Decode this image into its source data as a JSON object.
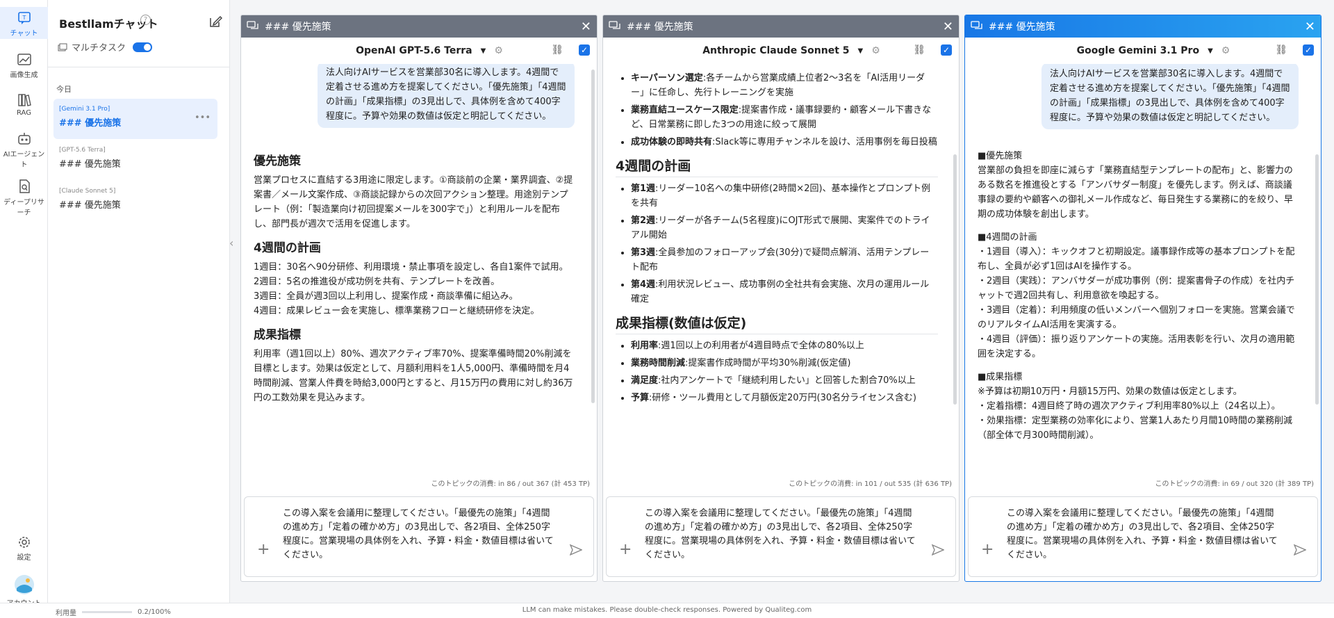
{
  "app": {
    "title": "Bestllamチャット",
    "multitask": "マルチタスク",
    "today": "今日",
    "footer": "LLM can make mistakes. Please double-check responses. Powered by Qualiteg.com",
    "usage_label": "利用量",
    "usage_value": "0.2/100%"
  },
  "rail": [
    "チャット",
    "画像生成",
    "RAG",
    "AIエージェント",
    "ディープリサーチ",
    "設定",
    "アカウント"
  ],
  "convs": [
    {
      "model": "[Gemini 3.1 Pro]",
      "title": "### 優先施策"
    },
    {
      "model": "[GPT-5.6 Terra]",
      "title": "### 優先施策"
    },
    {
      "model": "[Claude Sonnet 5]",
      "title": "### 優先施策"
    }
  ],
  "input_text": "この導入案を会議用に整理してください。「最優先の施策」「4週間の進め方」「定着の確かめ方」の3見出しで、各2項目、全体250字程度に。営業現場の具体例を入れ、予算・料金・数値目標は省いてください。",
  "user_msg": "法人向けAIサービスを営業部30名に導入します。4週間で定着させる進め方を提案してください。「優先施策」「4週間の計画」「成果指標」の3見出しで、具体例を含めて400字程度に。予算や効果の数値は仮定と明記してください。",
  "colors": {
    "header_gray": "#6c7380",
    "header_blue": "#1877e6",
    "accent": "#1a73e8"
  },
  "panels": [
    {
      "title": "### 優先施策",
      "model": "OpenAI GPT-5.6 Terra",
      "tokens": "このトピックの消費: in 86 / out 367 (計 453 TP)",
      "h1": "優先施策",
      "p1": "営業プロセスに直結する3用途に限定します。①商談前の企業・業界調査、②提案書／メール文案作成、③商談記録からの次回アクション整理。用途別テンプレート（例：「製造業向け初回提案メールを300字で」）と利用ルールを配布し、部門長が週次で活用を促進します。",
      "h2": "4週間の計画",
      "l1": "1週目：30名へ90分研修、利用環境・禁止事項を設定し、各自1案件で試用。",
      "l2": "2週目：5名の推進役が成功例を共有、テンプレートを改善。",
      "l3": "3週目：全員が週3回以上利用し、提案作成・商談準備に組込み。",
      "l4": "4週目：成果レビュー会を実施し、標準業務フローと継続研修を決定。",
      "h3": "成果指標",
      "p3": "利用率（週1回以上）80%、週次アクティブ率70%、提案準備時間20%削減を目標とします。効果は仮定として、月額利用料を1人5,000円、準備時間を月4時間削減、営業人件費を時給3,000円とすると、月15万円の費用に対し約36万円の工数効果を見込みます。"
    },
    {
      "title": "### 優先施策",
      "model": "Anthropic Claude Sonnet 5",
      "tokens": "このトピックの消費: in 101 / out 535 (計 636 TP)",
      "b1": "キーパーソン選定",
      "b1t": ":各チームから営業成績上位者2〜3名を「AI活用リーダー」に任命し、先行トレーニングを実施",
      "b2": "業務直結ユースケース限定",
      "b2t": ":提案書作成・議事録要約・顧客メール下書きなど、日常業務に即した3つの用途に絞って展開",
      "b3": "成功体験の即時共有",
      "b3t": ":Slack等に専用チャンネルを設け、活用事例を毎日投稿",
      "h2": "4週間の計画",
      "w1": "第1週",
      "w1t": ":リーダー10名への集中研修(2時間×2回)、基本操作とプロンプト例を共有",
      "w2": "第2週",
      "w2t": ":リーダーが各チーム(5名程度)にOJT形式で展開、実案件でのトライアル開始",
      "w3": "第3週",
      "w3t": ":全員参加のフォローアップ会(30分)で疑問点解消、活用テンプレート配布",
      "w4": "第4週",
      "w4t": ":利用状況レビュー、成功事例の全社共有会実施、次月の運用ルール確定",
      "h3": "成果指標(数値は仮定)",
      "k1": "利用率",
      "k1t": ":週1回以上の利用者が4週目時点で全体の80%以上",
      "k2": "業務時間削減",
      "k2t": ":提案書作成時間が平均30%削減(仮定値)",
      "k3": "満足度",
      "k3t": ":社内アンケートで「継続利用したい」と回答した割合70%以上",
      "k4": "予算",
      "k4t": ":研修・ツール費用として月額仮定20万円(30名分ライセンス含む)"
    },
    {
      "title": "### 優先施策",
      "model": "Google Gemini 3.1 Pro",
      "tokens": "このトピックの消費: in 69 / out 320 (計 389 TP)",
      "s1": "■優先施策",
      "p1": "営業部の負担を即座に減らす「業務直結型テンプレートの配布」と、影響力のある数名を推進役とする「アンバサダー制度」を優先します。例えば、商談議事録の要約や顧客への御礼メール作成など、毎日発生する業務に的を絞り、早期の成功体験を創出します。",
      "s2": "■4週間の計画",
      "l1": "・1週目（導入）：キックオフと初期設定。議事録作成等の基本プロンプトを配布し、全員が必ず1回はAIを操作する。",
      "l2": "・2週目（実践）：アンバサダーが成功事例（例：提案書骨子の作成）を社内チャットで週2回共有し、利用意欲を喚起する。",
      "l3": "・3週目（定着）：利用頻度の低いメンバーへ個別フォローを実施。営業会議でのリアルタイムAI活用を実演する。",
      "l4": "・4週目（評価）：振り返りアンケートの実施。活用表彰を行い、次月の適用範囲を決定する。",
      "s3": "■成果指標",
      "m1": "※予算は初期10万円・月額15万円、効果の数値は仮定とします。",
      "m2": "・定着指標：4週目終了時の週次アクティブ利用率80%以上（24名以上）。",
      "m3": "・効果指標：定型業務の効率化により、営業1人あたり月間10時間の業務削減（部全体で月300時間削減）。"
    }
  ]
}
